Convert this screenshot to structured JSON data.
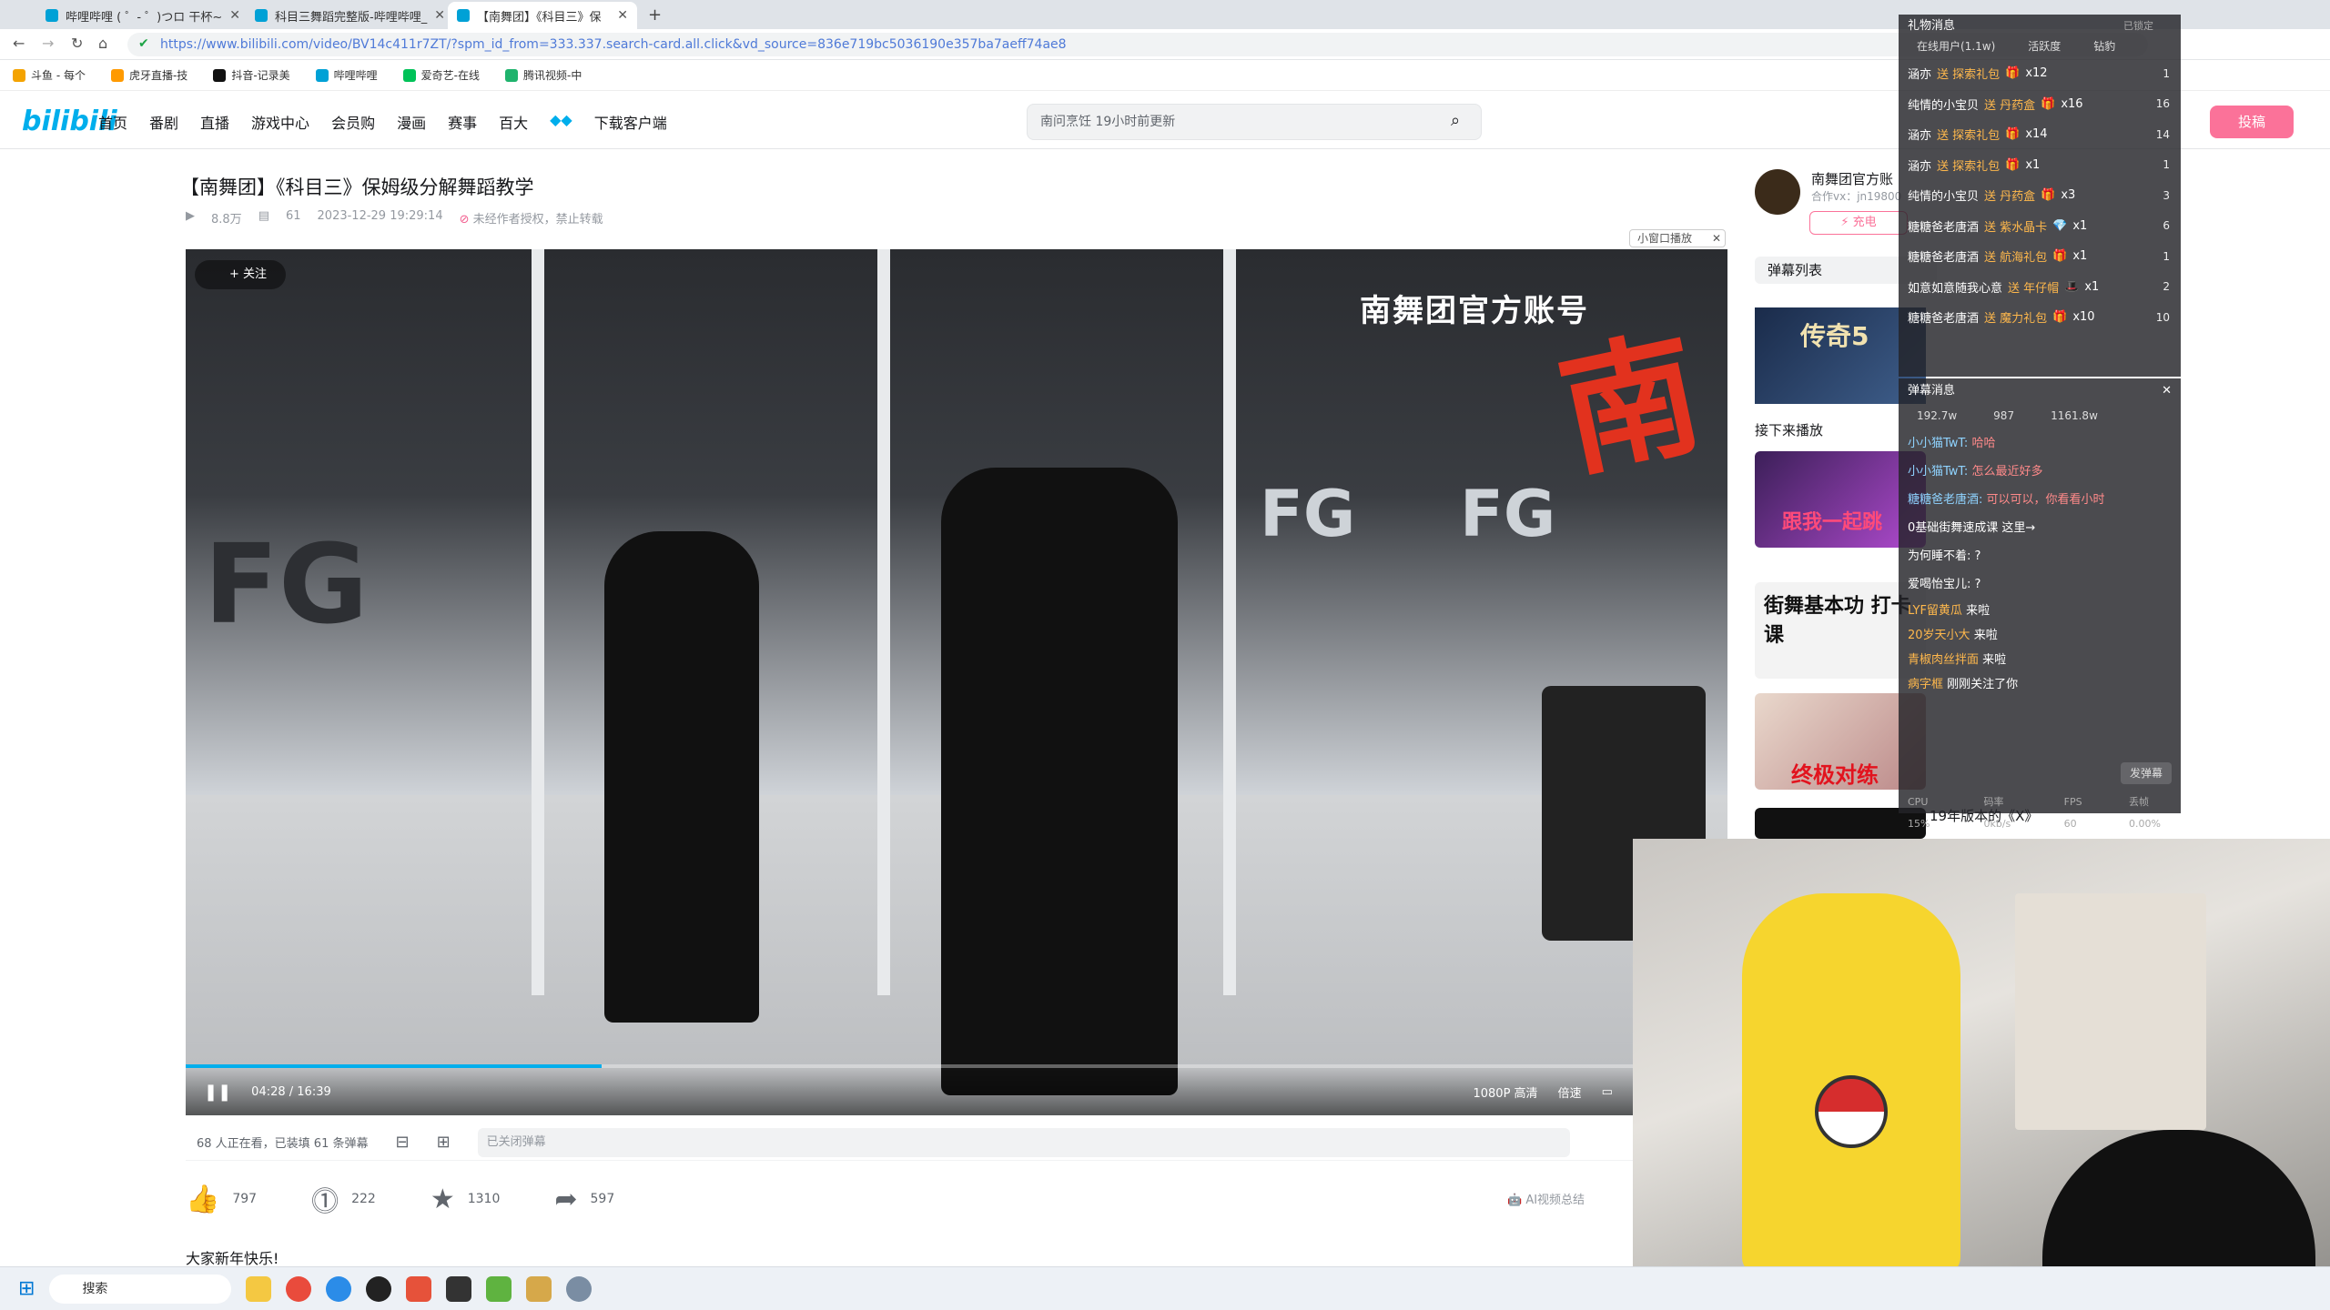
{
  "browser": {
    "tabs": [
      {
        "label": "哔哩哔哩 ( ゜- ゜)つロ 干杯~"
      },
      {
        "label": "科目三舞蹈完整版-哔哩哔哩_"
      },
      {
        "label": "【南舞团】《科目三》保"
      }
    ],
    "url": "https://www.bilibili.com/video/BV14c411r7ZT/?spm_id_from=333.337.search-card.all.click&vd_source=836e719bc5036190e357ba7aeff74ae8",
    "bookmarks": [
      "斗鱼 - 每个",
      "虎牙直播-技",
      "抖音-记录美",
      "哔哩哔哩",
      "爱奇艺-在线",
      "腾讯视频-中"
    ]
  },
  "header": {
    "logo": "bilibili",
    "nav": [
      "首页",
      "番剧",
      "直播",
      "游戏中心",
      "会员购",
      "漫画",
      "赛事",
      "百大",
      "下载客户端"
    ],
    "search_placeholder": "南问烹饪 19小时前更新",
    "upload": "投稿"
  },
  "video": {
    "title": "【南舞团】《科目三》保姆级分解舞蹈教学",
    "views": "8.8万",
    "danmaku_count": "61",
    "date": "2023-12-29 19:29:14",
    "copyright": "未经作者授权，禁止转载",
    "mini_window": "小窗口播放",
    "follow": "+ 关注",
    "watermark": "南舞团官方账号",
    "time": "04:28 / 16:39",
    "progress": 0.27,
    "quality": "1080P 高清",
    "speed": "倍速",
    "viewers_text": "68 人正在看，已装填 61 条弹幕",
    "danmaku_closed": "已关闭弹幕",
    "likes": "797",
    "coins": "222",
    "favs": "1310",
    "shares": "597",
    "ai_summary": "AI视频总结",
    "description": "大家新年快乐!"
  },
  "right": {
    "up_name": "南舞团官方账",
    "up_sub": "合作vx：jn19800",
    "charge": "充电",
    "danmaku_list": "弹幕列表",
    "ad_title": "传奇5",
    "next_label": "接下来播放",
    "rec_text_1": "跟我一起跳",
    "rec_text_2": "街舞基本功 打卡课",
    "rec_text_3": "终极对练",
    "rec_caption_4": "19年版本的《X》"
  },
  "gift_panel": {
    "title": "礼物消息",
    "status": "已锁定",
    "tabs": [
      "在线用户(1.1w)",
      "活跃度",
      "钻豹"
    ],
    "rows": [
      {
        "user": "涵亦",
        "gift": "送 探索礼包",
        "count": "x12",
        "n": "1"
      },
      {
        "user": "纯情的小宝贝",
        "gift": "送 丹药盒",
        "count": "x16",
        "n": "16"
      },
      {
        "user": "涵亦",
        "gift": "送 探索礼包",
        "count": "x14",
        "n": "14"
      },
      {
        "user": "涵亦",
        "gift": "送 探索礼包",
        "count": "x1",
        "n": "1"
      },
      {
        "user": "纯情的小宝贝",
        "gift": "送 丹药盒",
        "count": "x3",
        "n": "3"
      },
      {
        "user": "糖糖爸老唐酒",
        "gift": "送 紫水晶卡",
        "count": "x1",
        "n": "6"
      },
      {
        "user": "糖糖爸老唐酒",
        "gift": "送 航海礼包",
        "count": "x1",
        "n": "1"
      },
      {
        "user": "如意如意随我心意",
        "gift": "送 年仔帽",
        "count": "x1",
        "n": "2"
      },
      {
        "user": "糖糖爸老唐酒",
        "gift": "送 魔力礼包",
        "count": "x10",
        "n": "10"
      }
    ]
  },
  "danmaku_panel": {
    "title": "弹幕消息",
    "stats": [
      "192.7w",
      "987",
      "1161.8w"
    ],
    "rows": [
      {
        "user": "小小猫TwT:",
        "text": "哈哈"
      },
      {
        "user": "小小猫TwT:",
        "text": "怎么最近好多"
      },
      {
        "user": "糖糖爸老唐酒:",
        "text": "可以可以，你看看小时"
      },
      {
        "user": "",
        "text": "0基础街舞速成课 这里→"
      },
      {
        "user": "",
        "text": "为何睡不着: ?"
      },
      {
        "user": "",
        "text": "爱喝怡宝儿: ?"
      }
    ],
    "system": [
      {
        "user": "LYF留黄瓜",
        "text": "来啦"
      },
      {
        "user": "20岁天小大",
        "text": "来啦"
      },
      {
        "user": "青椒肉丝拌面",
        "text": "来啦"
      },
      {
        "user": "病字框",
        "text": "刚刚关注了你"
      }
    ],
    "send": "发弹幕",
    "footer": [
      "CPU 15%",
      "码率 0kb/s",
      "FPS 60",
      "丢帧 0.00%"
    ]
  },
  "taskbar": {
    "search": "搜索"
  }
}
